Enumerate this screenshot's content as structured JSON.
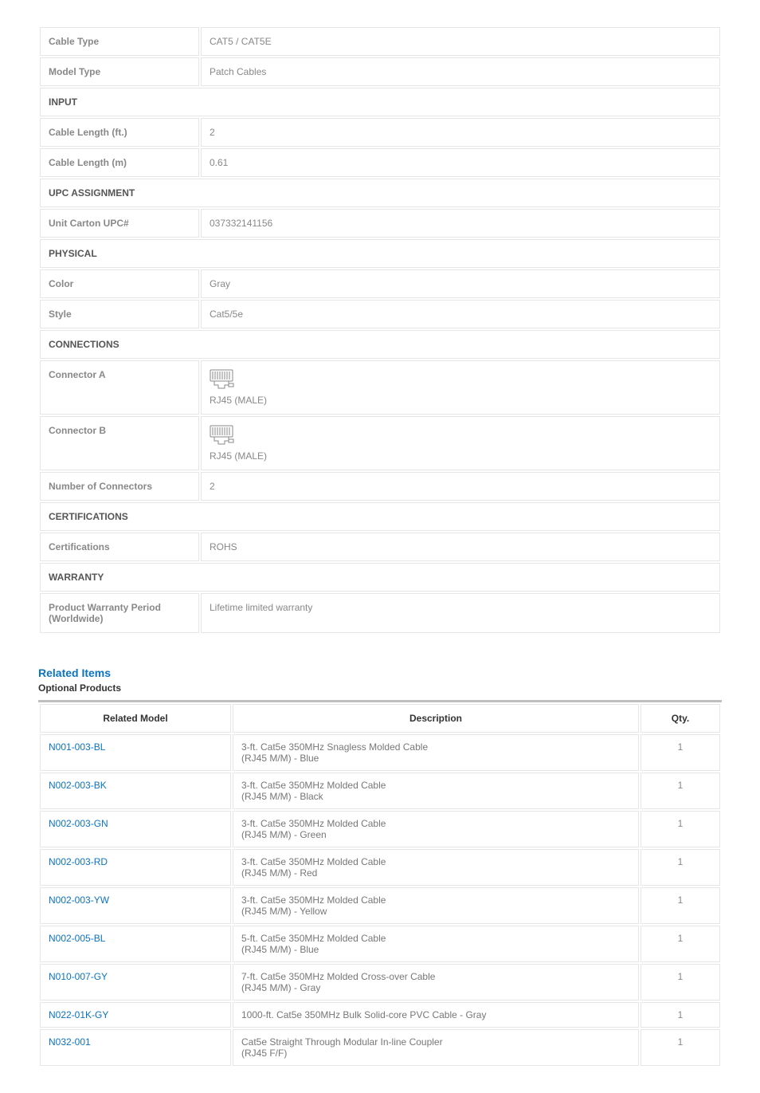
{
  "spec_table": {
    "rows": [
      {
        "type": "row",
        "label": "Cable Type",
        "value": "CAT5 / CAT5E"
      },
      {
        "type": "row",
        "label": "Model Type",
        "value": "Patch Cables"
      },
      {
        "type": "section",
        "label": "INPUT"
      },
      {
        "type": "row",
        "label": "Cable Length (ft.)",
        "value": "2"
      },
      {
        "type": "row",
        "label": "Cable Length (m)",
        "value": "0.61"
      },
      {
        "type": "section",
        "label": "UPC ASSIGNMENT"
      },
      {
        "type": "row",
        "label": "Unit Carton UPC#",
        "value": "037332141156"
      },
      {
        "type": "section",
        "label": "PHYSICAL"
      },
      {
        "type": "row",
        "label": "Color",
        "value": "Gray"
      },
      {
        "type": "row",
        "label": "Style",
        "value": "Cat5/5e"
      },
      {
        "type": "section",
        "label": "CONNECTIONS"
      },
      {
        "type": "connector",
        "label": "Connector A",
        "value": "RJ45 (MALE)"
      },
      {
        "type": "connector",
        "label": "Connector B",
        "value": "RJ45 (MALE)"
      },
      {
        "type": "row",
        "label": "Number of Connectors",
        "value": "2"
      },
      {
        "type": "section",
        "label": "CERTIFICATIONS"
      },
      {
        "type": "row",
        "label": "Certifications",
        "value": "ROHS"
      },
      {
        "type": "section",
        "label": "WARRANTY"
      },
      {
        "type": "row",
        "label": "Product Warranty Period (Worldwide)",
        "value": "Lifetime limited warranty"
      }
    ]
  },
  "related": {
    "heading": "Related Items",
    "subheading": "Optional Products",
    "columns": {
      "model": "Related Model",
      "description": "Description",
      "qty": "Qty."
    },
    "items": [
      {
        "model": "N001-003-BL",
        "desc1": "3-ft. Cat5e 350MHz Snagless Molded Cable",
        "desc2": "(RJ45 M/M) - Blue",
        "qty": "1"
      },
      {
        "model": "N002-003-BK",
        "desc1": "3-ft. Cat5e 350MHz Molded Cable",
        "desc2": "(RJ45 M/M) - Black",
        "qty": "1"
      },
      {
        "model": "N002-003-GN",
        "desc1": "3-ft. Cat5e 350MHz Molded Cable",
        "desc2": "(RJ45 M/M) - Green",
        "qty": "1"
      },
      {
        "model": "N002-003-RD",
        "desc1": "3-ft. Cat5e 350MHz Molded Cable",
        "desc2": "(RJ45 M/M) - Red",
        "qty": "1"
      },
      {
        "model": "N002-003-YW",
        "desc1": "3-ft. Cat5e 350MHz Molded Cable",
        "desc2": "(RJ45 M/M) - Yellow",
        "qty": "1"
      },
      {
        "model": "N002-005-BL",
        "desc1": "5-ft. Cat5e 350MHz Molded Cable",
        "desc2": "(RJ45 M/M) - Blue",
        "qty": "1"
      },
      {
        "model": "N010-007-GY",
        "desc1": "7-ft. Cat5e 350MHz Molded Cross-over Cable",
        "desc2": "(RJ45 M/M) - Gray",
        "qty": "1"
      },
      {
        "model": "N022-01K-GY",
        "desc1": "1000-ft. Cat5e 350MHz Bulk Solid-core PVC Cable - Gray",
        "desc2": "",
        "qty": "1"
      },
      {
        "model": "N032-001",
        "desc1": "Cat5e Straight Through Modular In-line Coupler",
        "desc2": "(RJ45 F/F)",
        "qty": "1"
      }
    ]
  }
}
